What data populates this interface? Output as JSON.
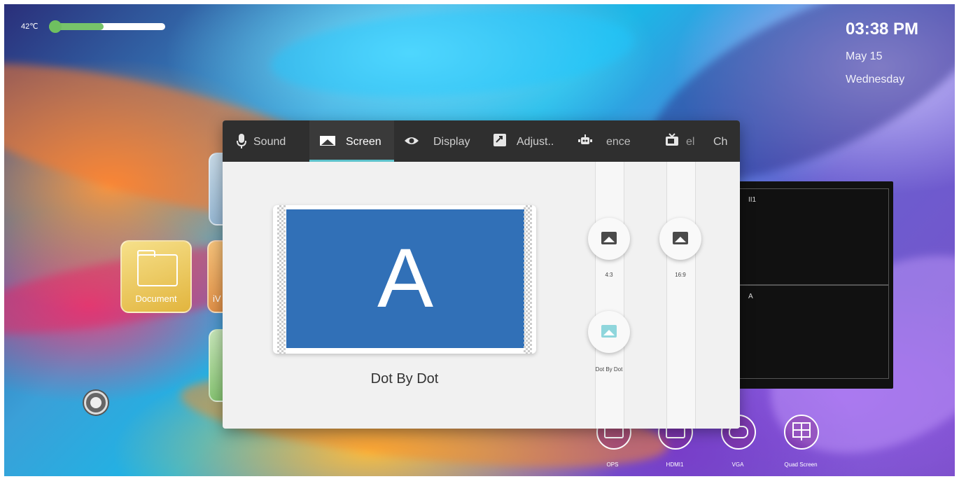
{
  "status": {
    "temperature": "42℃",
    "brightness_fraction": 0.47,
    "time": "03:38 PM",
    "date": "May 15",
    "weekday": "Wednesday"
  },
  "desktop_apps": [
    {
      "label": "Document",
      "icon": "folder-icon"
    },
    {
      "label": "iV",
      "icon": "app-icon"
    }
  ],
  "dialog": {
    "tabs": [
      {
        "label": "Sound",
        "icon": "microphone-icon",
        "active": false
      },
      {
        "label": "Screen",
        "icon": "screen-icon",
        "active": true
      },
      {
        "label": "Display",
        "icon": "eye-icon",
        "active": false
      },
      {
        "label": "Adjust..",
        "icon": "adjust-icon",
        "active": false
      },
      {
        "label": "ence",
        "icon": "robot-icon",
        "active": false
      },
      {
        "label": "el",
        "icon": "tv-icon",
        "active": false
      },
      {
        "label": "Ch",
        "icon": "",
        "active": false
      }
    ],
    "preview_letter": "A",
    "current_mode": "Dot By Dot",
    "options": [
      {
        "label": "4:3",
        "icon": "image-icon",
        "selected": false
      },
      {
        "label": "16:9",
        "icon": "image-icon",
        "selected": false
      },
      {
        "label": "Dot By Dot",
        "icon": "image-icon",
        "selected": true
      }
    ]
  },
  "preview_panel": {
    "cells": [
      "HDMI1",
      "VGA"
    ],
    "visible_text": [
      "II1",
      "A"
    ]
  },
  "dock": [
    {
      "label": "OPS",
      "icon": "ops-icon"
    },
    {
      "label": "HDMI1",
      "icon": "hdmi-icon"
    },
    {
      "label": "VGA",
      "icon": "vga-icon"
    },
    {
      "label": "Quad Screen",
      "icon": "quad-screen-icon"
    }
  ],
  "colors": {
    "accent": "#5ec3cc",
    "preview_blue": "#3170b7",
    "tabbar": "#2f2f2f",
    "temp_bar": "#77c46a"
  }
}
